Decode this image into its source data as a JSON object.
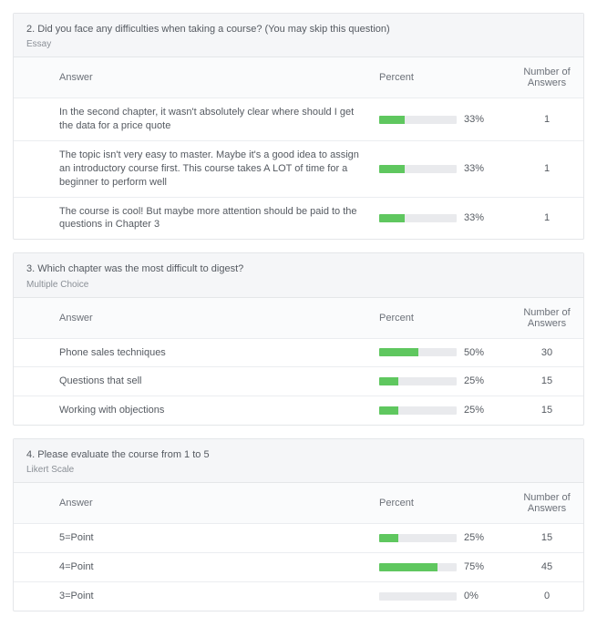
{
  "labels": {
    "answer": "Answer",
    "percent": "Percent",
    "count": "Number of Answers"
  },
  "questions": [
    {
      "title": "2. Did you face any difficulties when taking a course? (You may skip this question)",
      "type": "Essay",
      "rows": [
        {
          "answer": "In the second chapter, it wasn't absolutely clear where should I get the data for a price quote",
          "percent": 33,
          "percent_label": "33%",
          "count": 1
        },
        {
          "answer": "The topic isn't very easy to master. Maybe it's a good idea to assign an introductory course first. This course takes A LOT of time for a beginner to perform well",
          "percent": 33,
          "percent_label": "33%",
          "count": 1
        },
        {
          "answer": "The course is cool! But maybe more attention should be paid to the questions in Chapter 3",
          "percent": 33,
          "percent_label": "33%",
          "count": 1
        }
      ]
    },
    {
      "title": "3. Which chapter was the most difficult to digest?",
      "type": "Multiple Choice",
      "rows": [
        {
          "answer": "Phone sales techniques",
          "percent": 50,
          "percent_label": "50%",
          "count": 30
        },
        {
          "answer": "Questions that sell",
          "percent": 25,
          "percent_label": "25%",
          "count": 15
        },
        {
          "answer": "Working with objections",
          "percent": 25,
          "percent_label": "25%",
          "count": 15
        }
      ]
    },
    {
      "title": "4. Please evaluate the course from 1 to 5",
      "type": "Likert Scale",
      "rows": [
        {
          "answer": "5=Point",
          "percent": 25,
          "percent_label": "25%",
          "count": 15
        },
        {
          "answer": "4=Point",
          "percent": 75,
          "percent_label": "75%",
          "count": 45
        },
        {
          "answer": "3=Point",
          "percent": 0,
          "percent_label": "0%",
          "count": 0
        }
      ]
    }
  ],
  "chart_data": [
    {
      "type": "bar",
      "title": "2. Did you face any difficulties when taking a course? (You may skip this question)",
      "question_type": "Essay",
      "xlabel": "Percent",
      "ylabel": "Answer",
      "xlim": [
        0,
        100
      ],
      "categories": [
        "In the second chapter, it wasn't absolutely clear where should I get the data for a price quote",
        "The topic isn't very easy to master. Maybe it's a good idea to assign an introductory course first. This course takes A LOT of time for a beginner to perform well",
        "The course is cool! But maybe more attention should be paid to the questions in Chapter 3"
      ],
      "series": [
        {
          "name": "Percent",
          "values": [
            33,
            33,
            33
          ]
        },
        {
          "name": "Number of Answers",
          "values": [
            1,
            1,
            1
          ]
        }
      ]
    },
    {
      "type": "bar",
      "title": "3. Which chapter was the most difficult to digest?",
      "question_type": "Multiple Choice",
      "xlabel": "Percent",
      "ylabel": "Answer",
      "xlim": [
        0,
        100
      ],
      "categories": [
        "Phone sales techniques",
        "Questions that sell",
        "Working with objections"
      ],
      "series": [
        {
          "name": "Percent",
          "values": [
            50,
            25,
            25
          ]
        },
        {
          "name": "Number of Answers",
          "values": [
            30,
            15,
            15
          ]
        }
      ]
    },
    {
      "type": "bar",
      "title": "4. Please evaluate the course from 1 to 5",
      "question_type": "Likert Scale",
      "xlabel": "Percent",
      "ylabel": "Answer",
      "xlim": [
        0,
        100
      ],
      "categories": [
        "5=Point",
        "4=Point",
        "3=Point"
      ],
      "series": [
        {
          "name": "Percent",
          "values": [
            25,
            75,
            0
          ]
        },
        {
          "name": "Number of Answers",
          "values": [
            15,
            45,
            0
          ]
        }
      ]
    }
  ]
}
